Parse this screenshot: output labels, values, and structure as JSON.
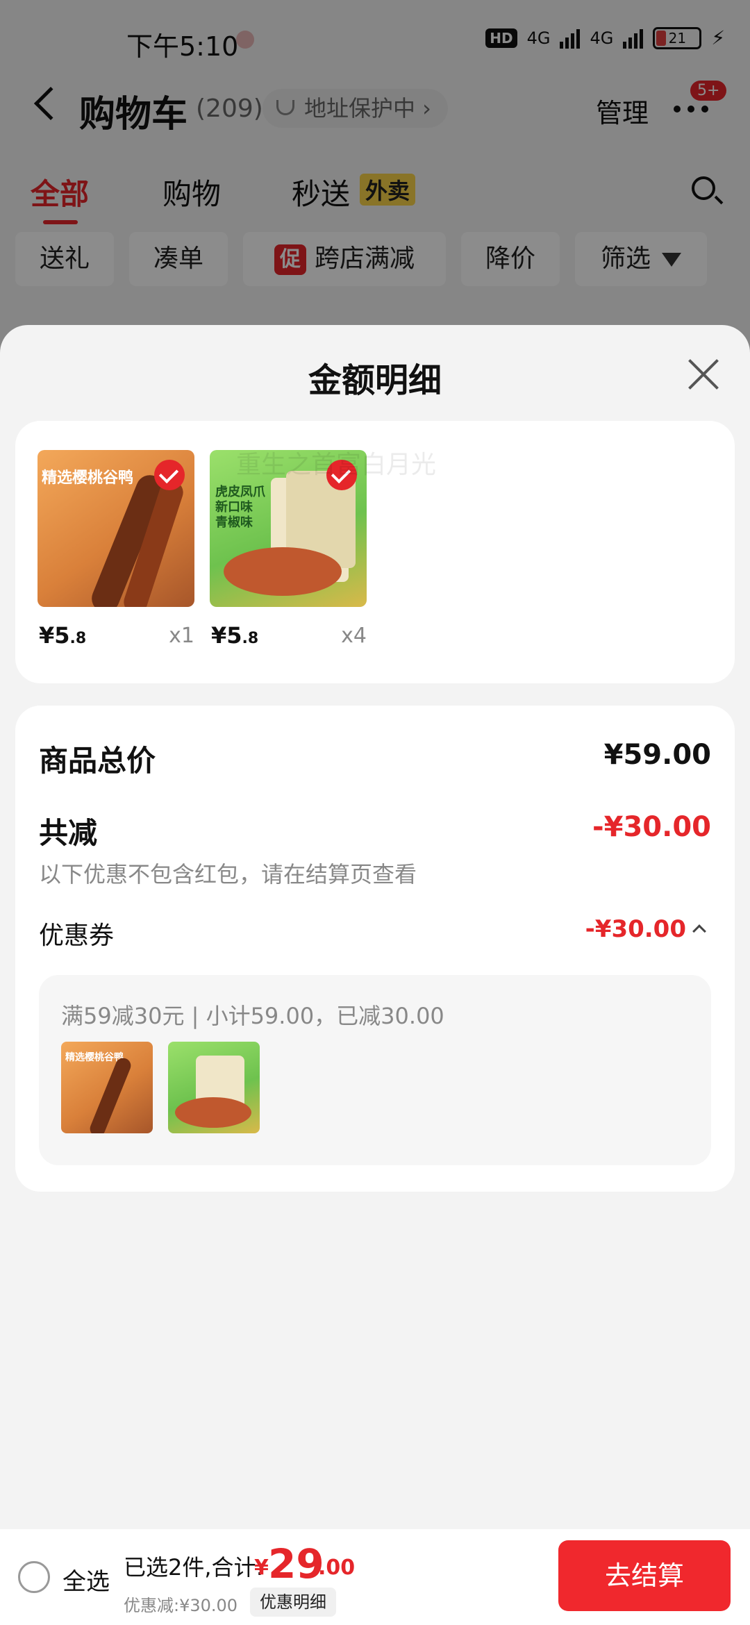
{
  "status_bar": {
    "time": "下午5:10",
    "hd": "HD",
    "net1": "4G",
    "net2": "4G",
    "battery": "21"
  },
  "nav": {
    "title": "购物车",
    "count": "(209)",
    "address": "地址保护中 ›",
    "manage": "管理",
    "badge": "5+"
  },
  "tabs": [
    {
      "label": "全部"
    },
    {
      "label": "购物"
    },
    {
      "label": "秒送"
    }
  ],
  "tab_tag": "外卖",
  "filters": [
    {
      "label": "送礼"
    },
    {
      "label": "凑单"
    },
    {
      "label": "跨店满减",
      "icon_text": "促"
    },
    {
      "label": "降价"
    },
    {
      "label": "筛选"
    }
  ],
  "sheet": {
    "title": "金额明细",
    "products": [
      {
        "thumb_title": "精选樱桃谷鸭",
        "price_int": "¥5",
        "price_dec": ".8",
        "qty": "x1"
      },
      {
        "thumb_title": "虎皮凤爪 新口味 青椒味",
        "price_int": "¥5",
        "price_dec": ".8",
        "qty": "x4"
      }
    ],
    "summary": {
      "goods_total_label": "商品总价",
      "goods_total_value": "¥59.00",
      "reduce_label": "共减",
      "reduce_value": "-¥30.00",
      "note": "以下优惠不包含红包，请在结算页查看",
      "coupon_label": "优惠券",
      "coupon_value": "-¥30.00",
      "coupon_desc": "满59减30元 | 小计59.00，已减30.00"
    }
  },
  "watermark": "重生之首富白月光",
  "bottom": {
    "select_all": "全选",
    "selected": "已选2件,合计:",
    "yen": "¥",
    "total_int": "29",
    "total_dec": ".00",
    "discount": "优惠减:¥30.00",
    "detail_button": "优惠明细",
    "checkout": "去结算"
  },
  "colors": {
    "accent": "#e5262a",
    "checkout": "#f0282d",
    "tag_yellow": "#f9d44a"
  }
}
